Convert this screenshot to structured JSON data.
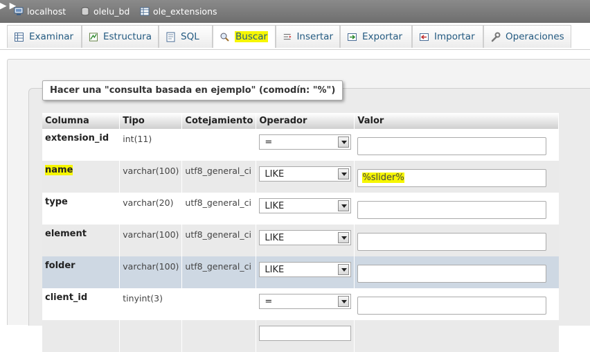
{
  "breadcrumb": {
    "server": "localhost",
    "database": "olelu_bd",
    "table": "ole_extensions"
  },
  "tabs": [
    {
      "label": "Examinar",
      "icon": "browse-icon"
    },
    {
      "label": "Estructura",
      "icon": "structure-icon"
    },
    {
      "label": "SQL",
      "icon": "sql-icon"
    },
    {
      "label": "Buscar",
      "icon": "search-icon",
      "active": true
    },
    {
      "label": "Insertar",
      "icon": "insert-icon"
    },
    {
      "label": "Exportar",
      "icon": "export-icon"
    },
    {
      "label": "Importar",
      "icon": "import-icon"
    },
    {
      "label": "Operaciones",
      "icon": "wrench-icon"
    }
  ],
  "search": {
    "legend": "Hacer una \"consulta basada en ejemplo\" (comodín: \"%\")",
    "headers": {
      "column": "Columna",
      "type": "Tipo",
      "collation": "Cotejamiento",
      "operator": "Operador",
      "value": "Valor"
    },
    "rows": [
      {
        "column": "extension_id",
        "type": "int(11)",
        "collation": "",
        "operator": "=",
        "value": ""
      },
      {
        "column": "name",
        "type": "varchar(100)",
        "collation": "utf8_general_ci",
        "operator": "LIKE",
        "value": "%slider%"
      },
      {
        "column": "type",
        "type": "varchar(20)",
        "collation": "utf8_general_ci",
        "operator": "LIKE",
        "value": ""
      },
      {
        "column": "element",
        "type": "varchar(100)",
        "collation": "utf8_general_ci",
        "operator": "LIKE",
        "value": ""
      },
      {
        "column": "folder",
        "type": "varchar(100)",
        "collation": "utf8_general_ci",
        "operator": "LIKE",
        "value": ""
      },
      {
        "column": "client_id",
        "type": "tinyint(3)",
        "collation": "",
        "operator": "=",
        "value": ""
      }
    ]
  },
  "colors": {
    "highlight": "#f6f600",
    "link": "#235a81",
    "hover_row": "#ced8e3"
  }
}
